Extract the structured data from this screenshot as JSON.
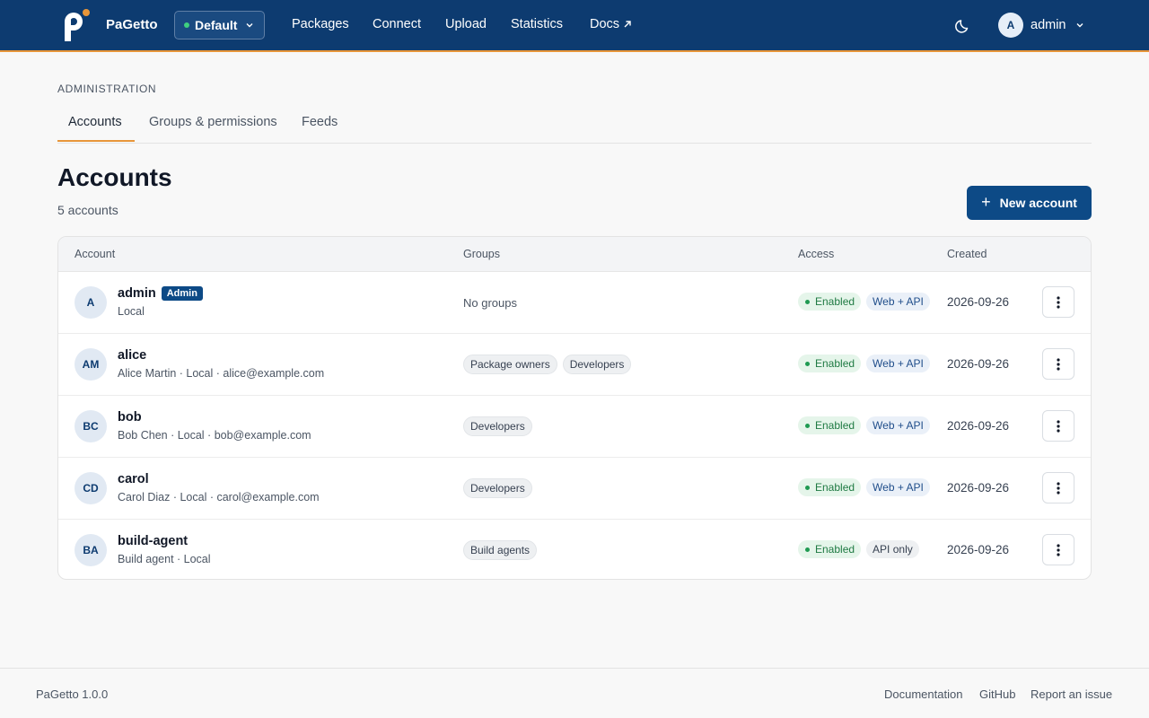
{
  "header": {
    "brand": "PaGetto",
    "feed": "Default",
    "nav": [
      "Packages",
      "Connect",
      "Upload",
      "Statistics",
      "Docs"
    ],
    "user_initial": "A",
    "user_name": "admin"
  },
  "admin": {
    "section_label": "ADMINISTRATION",
    "tabs": [
      "Accounts",
      "Groups & permissions",
      "Feeds"
    ]
  },
  "page": {
    "title": "Accounts",
    "subtitle": "5 accounts",
    "new_button": "New account"
  },
  "table": {
    "columns": [
      "Account",
      "Groups",
      "Access",
      "Created"
    ],
    "rows": [
      {
        "initials": "A",
        "name": "admin",
        "badge": "Admin",
        "detail": "Local",
        "groups": [],
        "no_groups": "No groups",
        "status": "Enabled",
        "access": "Web + API",
        "created": "2026-09-26"
      },
      {
        "initials": "AM",
        "name": "alice",
        "detail": "Alice Martin · Local · alice@example.com",
        "groups": [
          "Package owners",
          "Developers"
        ],
        "status": "Enabled",
        "access": "Web + API",
        "created": "2026-09-26"
      },
      {
        "initials": "BC",
        "name": "bob",
        "detail": "Bob Chen · Local · bob@example.com",
        "groups": [
          "Developers"
        ],
        "status": "Enabled",
        "access": "Web + API",
        "created": "2026-09-26"
      },
      {
        "initials": "CD",
        "name": "carol",
        "detail": "Carol Diaz · Local · carol@example.com",
        "groups": [
          "Developers"
        ],
        "status": "Enabled",
        "access": "Web + API",
        "created": "2026-09-26"
      },
      {
        "initials": "BA",
        "name": "build-agent",
        "detail": "Build agent · Local",
        "groups": [
          "Build agents"
        ],
        "status": "Enabled",
        "access": "API only",
        "created": "2026-09-26"
      }
    ]
  },
  "footer": {
    "version": "PaGetto 1.0.0",
    "links": [
      "Documentation",
      "GitHub",
      "Report an issue"
    ]
  },
  "colors": {
    "nav_bg": "#0d3b70",
    "accent": "#e8963a",
    "primary_button": "#0d4a86",
    "status_green": "#1f7a43"
  }
}
